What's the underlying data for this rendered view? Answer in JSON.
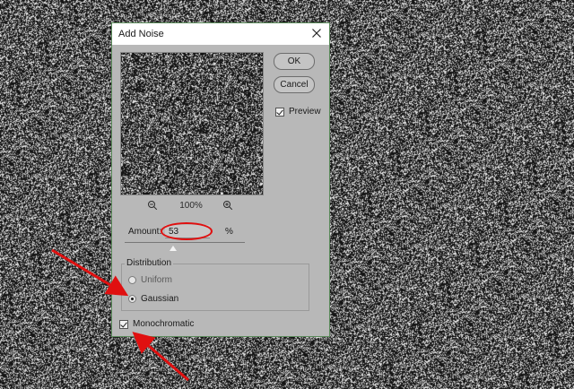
{
  "dialog": {
    "title": "Add Noise",
    "zoom_level": "100%",
    "buttons": {
      "ok": "OK",
      "cancel": "Cancel"
    },
    "preview": {
      "label": "Preview",
      "checked": true
    },
    "amount": {
      "label": "Amount:",
      "value": "53",
      "unit": "%",
      "slider_fraction": 0.4
    },
    "distribution": {
      "label": "Distribution",
      "options": [
        {
          "label": "Uniform",
          "selected": false
        },
        {
          "label": "Gaussian",
          "selected": true
        }
      ]
    },
    "monochromatic": {
      "label": "Monochromatic",
      "checked": true
    }
  },
  "annotation_color": "#e01010",
  "icons": [
    "close-icon",
    "zoom-out-icon",
    "zoom-in-icon",
    "arrow-annotation"
  ]
}
